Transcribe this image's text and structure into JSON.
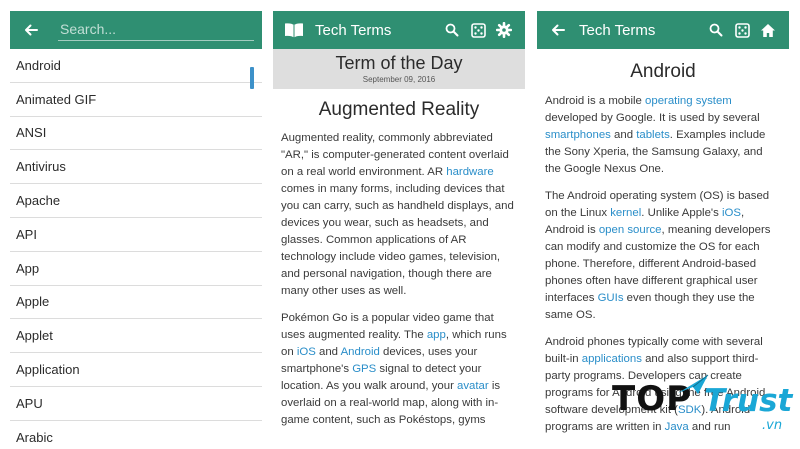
{
  "colors": {
    "appbar": "#2f8f72",
    "link": "#2a8ec9",
    "accent": "#3d91c9",
    "brand_blue": "#1aa7d6"
  },
  "search_screen": {
    "search_placeholder": "Search...",
    "items": [
      "Android",
      "Animated GIF",
      "ANSI",
      "Antivirus",
      "Apache",
      "API",
      "App",
      "Apple",
      "Applet",
      "Application",
      "APU",
      "Arabic"
    ]
  },
  "totd_screen": {
    "app_title": "Tech Terms",
    "icons": [
      "book-icon",
      "search-icon",
      "dice-icon",
      "gear-icon"
    ],
    "heading": "Term of the Day",
    "date": "September 09, 2016",
    "term": "Augmented Reality",
    "p1": {
      "a": "Augmented reality, commonly abbreviated \"AR,\" is computer-generated content overlaid on a real world environment. AR ",
      "link1": "hardware",
      "b": " comes in many forms, including devices that you can carry, such as handheld displays, and devices you wear, such as headsets, and glasses. Common applications of AR technology include video games, television, and personal navigation, though there are many other uses as well."
    },
    "p2": {
      "a": "Pokémon Go is a popular video game that uses augmented reality. The ",
      "link1": "app",
      "b": ", which runs on ",
      "link2": "iOS",
      "c": " and ",
      "link3": "Android",
      "d": " devices, uses your smartphone's ",
      "link4": "GPS",
      "e": " signal to detect your location. As you walk around, your ",
      "link5": "avatar",
      "f": " is overlaid on a real-world map, along with in-game content, such as Pokéstops, gyms"
    }
  },
  "android_screen": {
    "app_title": "Tech Terms",
    "icons": [
      "back-arrow-icon",
      "search-icon",
      "dice-icon",
      "home-icon"
    ],
    "term": "Android",
    "p1": {
      "a": "Android is a mobile ",
      "link1": "operating system",
      "b": " developed by Google. It is used by several ",
      "link2": "smartphones",
      "c": " and ",
      "link3": "tablets",
      "d": ". Examples include the Sony Xperia, the Samsung Galaxy, and the Google Nexus One."
    },
    "p2": {
      "a": "The Android operating system (OS) is based on the Linux ",
      "link1": "kernel",
      "b": ". Unlike Apple's ",
      "link2": "iOS",
      "c": ", Android is ",
      "link3": "open source",
      "d": ", meaning developers can modify and customize the OS for each phone. Therefore, different Android-based phones often have different graphical user interfaces ",
      "link4": "GUIs",
      "e": " even though they use the same OS."
    },
    "p3": {
      "a": "Android phones typically come with several built-in ",
      "link1": "applications",
      "b": " and also support third-party programs. Developers can create programs for Android using the free Android software development kit (",
      "link2": "SDK",
      "c": "). Android programs are written in ",
      "link3": "Java",
      "d": " and run"
    }
  },
  "watermark": {
    "word1": "TOP",
    "word2": "Trust",
    "suffix": ".vn"
  }
}
